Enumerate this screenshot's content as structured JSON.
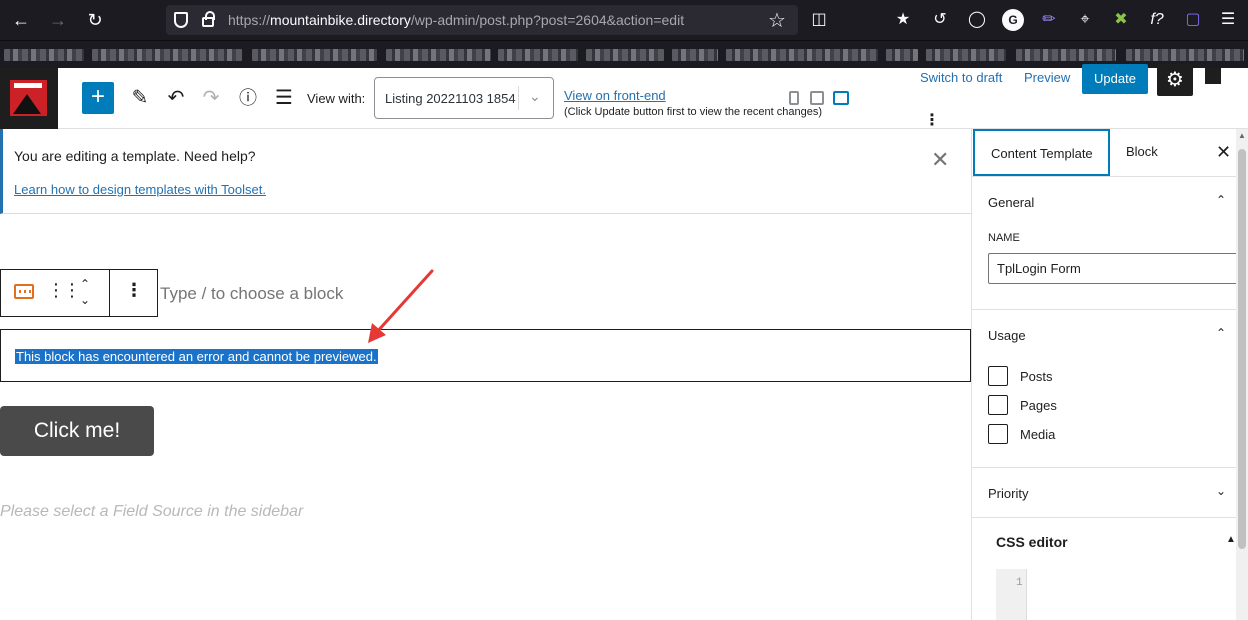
{
  "browser": {
    "url_host": "mountainbike.directory",
    "url_prefix": "https://",
    "url_path": "/wp-admin/post.php?post=2604&action=edit"
  },
  "header": {
    "view_with_label": "View with:",
    "view_select_value": "Listing 20221103 1854",
    "view_frontend_link": "View on front-end",
    "update_note": "(Click Update button first to view the recent changes)",
    "switch_draft": "Switch to draft",
    "preview": "Preview",
    "update": "Update"
  },
  "notice": {
    "text": "You are editing a template. Need help?",
    "link": "Learn how to design templates with Toolset."
  },
  "canvas": {
    "placeholder": "Type / to choose a block",
    "error_text": "This block has encountered an error and cannot be previewed.",
    "button_label": "Click me!",
    "field_source_hint": "Please select a Field Source in the sidebar"
  },
  "sidebar": {
    "tabs": [
      {
        "label": "Content Template"
      },
      {
        "label": "Block"
      }
    ],
    "general": {
      "title": "General",
      "name_label": "NAME",
      "name_value": "TplLogin Form"
    },
    "usage": {
      "title": "Usage",
      "options": [
        {
          "label": "Posts"
        },
        {
          "label": "Pages"
        },
        {
          "label": "Media"
        }
      ]
    },
    "priority": {
      "title": "Priority"
    },
    "css_editor": {
      "title": "CSS editor",
      "line_number": "1"
    }
  },
  "colors": {
    "wp_blue": "#007cba",
    "link_blue": "#2271b1",
    "arrow_red": "#e53935",
    "selection": "#1a73c9"
  }
}
